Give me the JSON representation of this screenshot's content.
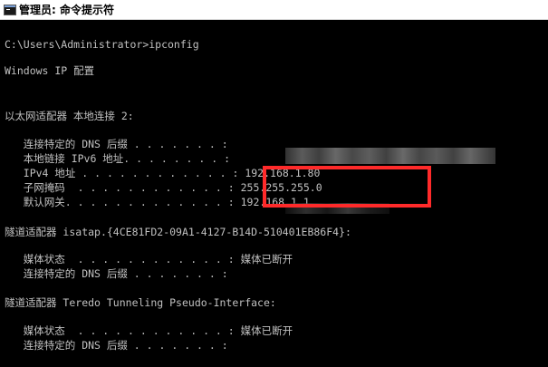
{
  "window": {
    "title": "管理员: 命令提示符"
  },
  "console": {
    "lines": [
      "C:\\Users\\Administrator>ipconfig",
      "Windows IP 配置",
      "以太网适配器 本地连接 2:",
      "   连接特定的 DNS 后缀 . . . . . . . :",
      "   本地链接 IPv6 地址. . . . . . . . :",
      "   IPv4 地址 . . . . . . . . . . . . : 192.168.1.80",
      "   子网掩码  . . . . . . . . . . . . : 255.255.255.0",
      "   默认网关. . . . . . . . . . . . . : 192.168.1.1",
      "隧道适配器 isatap.{4CE81FD2-09A1-4127-B14D-510401EB86F4}:",
      "   媒体状态  . . . . . . . . . . . . : 媒体已断开",
      "   连接特定的 DNS 后缀 . . . . . . . :",
      "隧道适配器 Teredo Tunneling Pseudo-Interface:",
      "   媒体状态  . . . . . . . . . . . . : 媒体已断开",
      "   连接特定的 DNS 后缀 . . . . . . . :"
    ]
  },
  "colors": {
    "console_background": "#000000",
    "console_text": "#c0c0c0",
    "highlight_border": "#ff2a2a",
    "titlebar_background": "#ffffff"
  },
  "icons": {
    "title_icon": "cmd-icon"
  }
}
